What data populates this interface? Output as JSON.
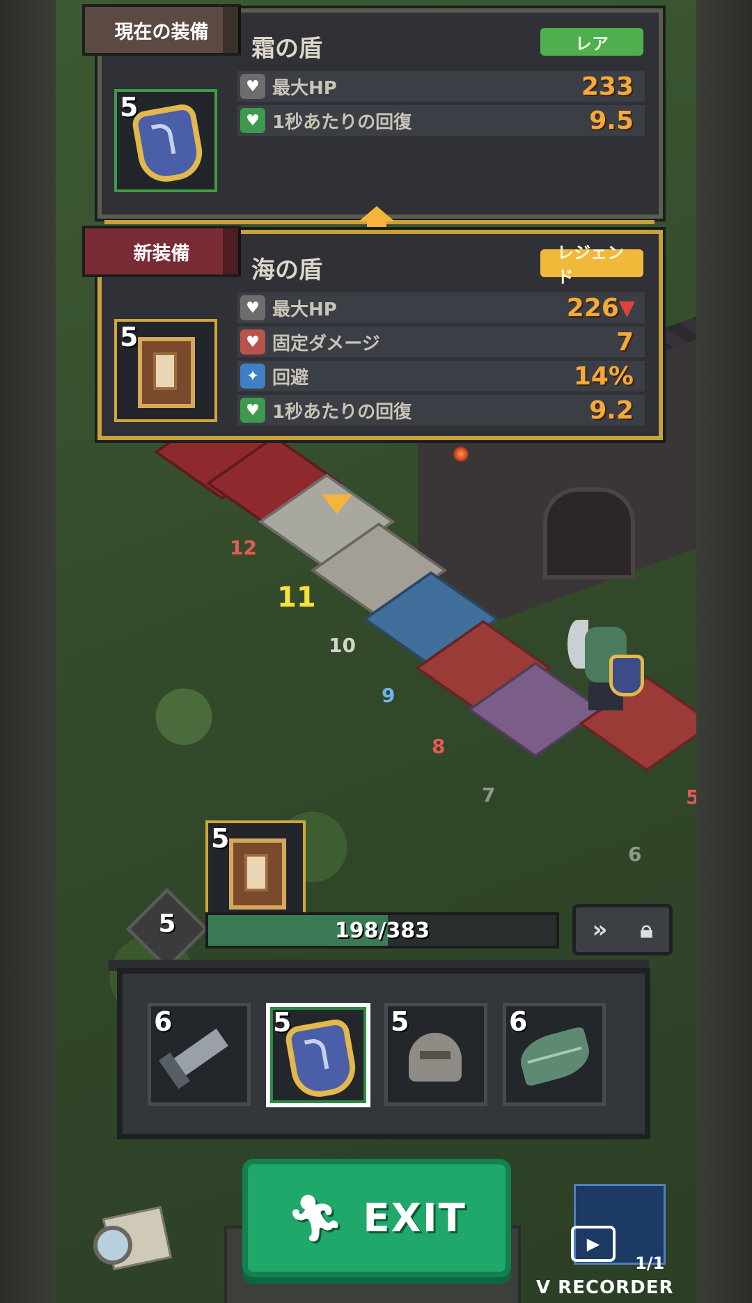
{
  "current_panel": {
    "tag": "現在の装備",
    "item_name": "霜の盾",
    "rarity": "レア",
    "level": "5",
    "stats": [
      {
        "label": "最大HP",
        "value": "233",
        "icon": "heart-icon"
      },
      {
        "label": "1秒あたりの回復",
        "value": "9.5",
        "icon": "regen-heart-icon"
      }
    ]
  },
  "new_panel": {
    "tag": "新装備",
    "item_name": "海の盾",
    "rarity": "レジェンド",
    "level": "5",
    "stats": [
      {
        "label": "最大HP",
        "value": "226",
        "icon": "heart-icon",
        "trend": "down"
      },
      {
        "label": "固定ダメージ",
        "value": "7",
        "icon": "broken-heart-icon"
      },
      {
        "label": "回避",
        "value": "14%",
        "icon": "dodge-icon"
      },
      {
        "label": "1秒あたりの回復",
        "value": "9.2",
        "icon": "regen-heart-icon"
      }
    ]
  },
  "map": {
    "tile_numbers": [
      "12",
      "11",
      "10",
      "9",
      "8",
      "7",
      "6",
      "5"
    ]
  },
  "drop": {
    "level": "5"
  },
  "progress": {
    "level": "5",
    "xp_text": "198/383",
    "xp_current": 198,
    "xp_max": 383
  },
  "inventory": {
    "slots": [
      {
        "level": "6",
        "icon": "sword-icon"
      },
      {
        "level": "5",
        "icon": "frost-shield-icon",
        "selected": true
      },
      {
        "level": "5",
        "icon": "helmet-icon"
      },
      {
        "level": "6",
        "icon": "leaf-armor-icon"
      }
    ]
  },
  "exit_label": "EXIT",
  "recorder": {
    "label": "V RECORDER",
    "count": "1/1"
  },
  "colors": {
    "rarity_rare": "#4fae4d",
    "rarity_legend": "#f0b93a",
    "stat_value": "#f5a93a",
    "exit_green": "#1fa86a",
    "decrease_red": "#e0423a"
  }
}
